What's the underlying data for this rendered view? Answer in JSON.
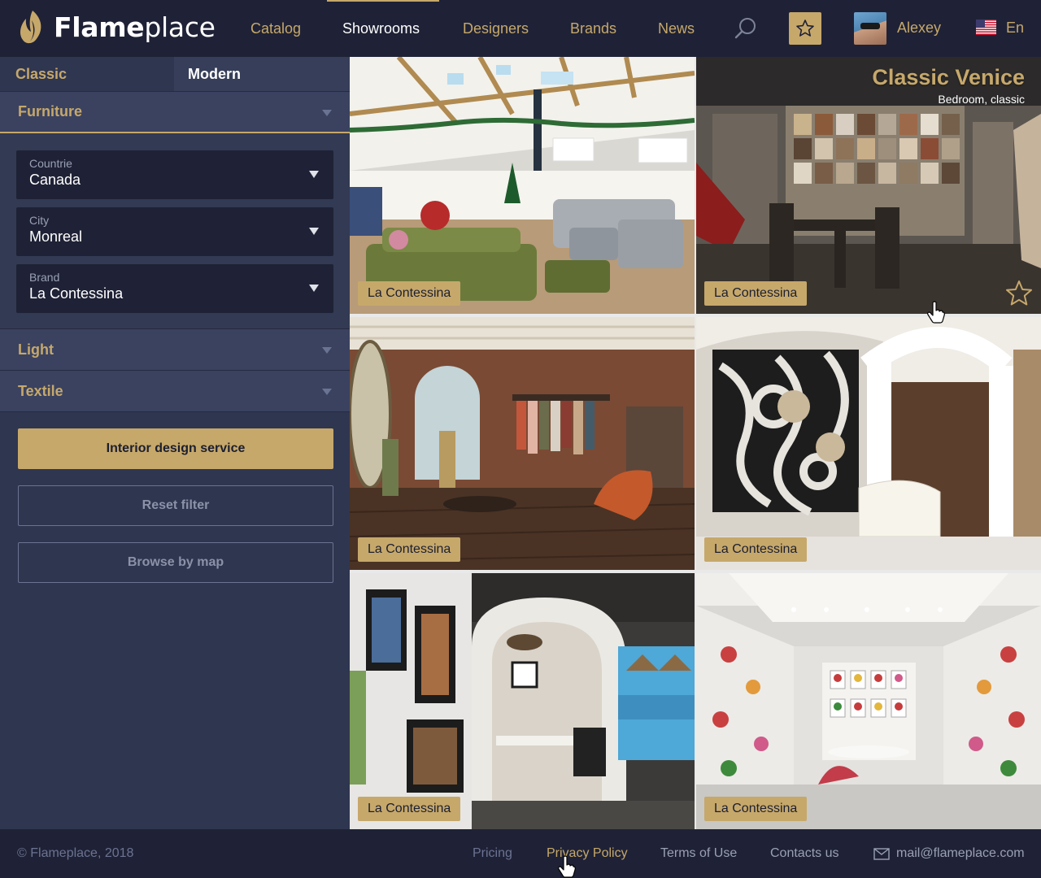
{
  "brand": {
    "name_bold": "Flame",
    "name_light": "place",
    "logo_icon": "flame-logo-icon"
  },
  "nav": {
    "items": [
      {
        "label": "Catalog",
        "active": false
      },
      {
        "label": "Showrooms",
        "active": true
      },
      {
        "label": "Designers",
        "active": false
      },
      {
        "label": "Brands",
        "active": false
      },
      {
        "label": "News",
        "active": false
      }
    ],
    "search_icon": "search-icon",
    "favorites_icon": "star-icon"
  },
  "user": {
    "name": "Alexey",
    "avatar": "avatar"
  },
  "language": {
    "label": "En",
    "flag_icon": "us-flag-icon"
  },
  "sidebar": {
    "styles": [
      {
        "label": "Classic"
      },
      {
        "label": "Modern"
      }
    ],
    "furniture": {
      "label": "Furniture",
      "filters": [
        {
          "label": "Countrie",
          "value": "Canada"
        },
        {
          "label": "City",
          "value": "Monreal"
        },
        {
          "label": "Brand",
          "value": "La Contessina"
        }
      ]
    },
    "light": {
      "label": "Light"
    },
    "textile": {
      "label": "Textile"
    },
    "buttons": {
      "primary": "Interior design service",
      "reset": "Reset filter",
      "map": "Browse by map"
    }
  },
  "showrooms": [
    {
      "brand": "La Contessina"
    },
    {
      "brand": "La Contessina",
      "title": "Classic Venice",
      "subtitle": "Bedroom, classic"
    },
    {
      "brand": "La Contessina"
    },
    {
      "brand": "La Contessina"
    },
    {
      "brand": "La Contessina"
    },
    {
      "brand": "La Contessina"
    }
  ],
  "footer": {
    "copyright": "© Flameplace, 2018",
    "links": [
      {
        "label": "Pricing"
      },
      {
        "label": "Privacy Policy"
      },
      {
        "label": "Terms of Use"
      },
      {
        "label": "Contacts us"
      }
    ],
    "email": "mail@flameplace.com"
  },
  "colors": {
    "accent": "#c6a86b",
    "header_bg": "#1f2236",
    "sidebar_bg": "#2f3650"
  }
}
